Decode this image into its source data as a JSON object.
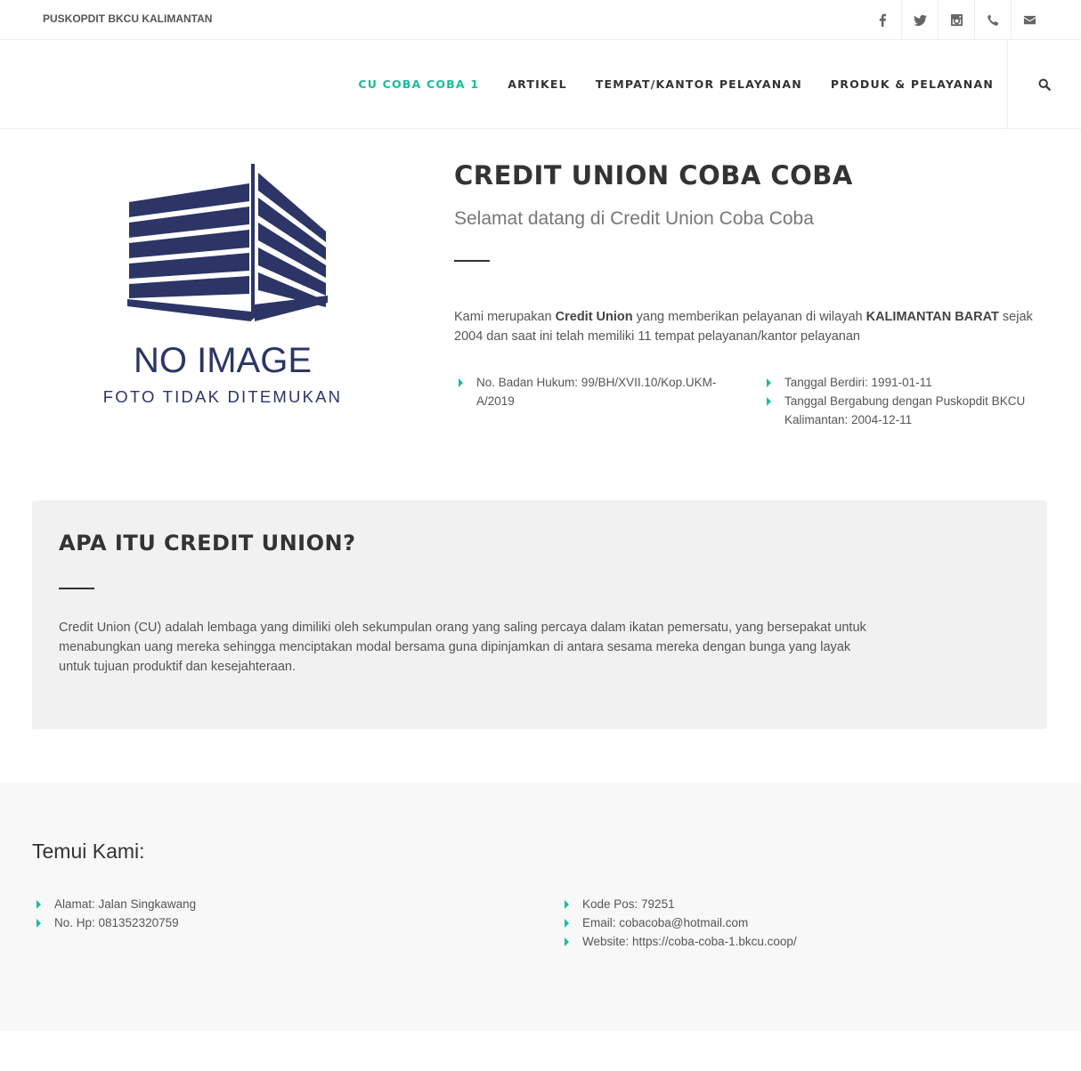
{
  "topbar": {
    "org_name": "PUSKOPDIT BKCU KALIMANTAN",
    "social_icons": [
      "facebook-icon",
      "twitter-icon",
      "instagram-icon",
      "phone-icon",
      "mail-icon"
    ]
  },
  "nav": {
    "items": [
      {
        "label": "CU COBA COBA 1",
        "active": true
      },
      {
        "label": "ARTIKEL",
        "active": false
      },
      {
        "label": "TEMPAT/KANTOR PELAYANAN",
        "active": false
      },
      {
        "label": "PRODUK & PELAYANAN",
        "active": false
      }
    ],
    "search_icon": "search-icon"
  },
  "hero": {
    "image_title": "NO IMAGE",
    "image_caption": "FOTO TIDAK DITEMUKAN",
    "title": "CREDIT UNION COBA COBA",
    "subtitle": "Selamat datang di Credit Union Coba Coba",
    "desc": {
      "p1": "Kami merupakan ",
      "b1": "Credit Union",
      "p2": " yang memberikan pelayanan di wilayah ",
      "b2": "KALIMANTAN BARAT",
      "p3": " sejak 2004 dan saat ini telah memiliki 11 tempat pelayanan/kantor pelayanan"
    },
    "facts_left": [
      "No. Badan Hukum: 99/BH/XVII.10/Kop.UKM-A/2019"
    ],
    "facts_right": [
      "Tanggal Berdiri: 1991-01-11",
      "Tanggal Bergabung dengan Puskopdit BKCU Kalimantan: 2004-12-11"
    ]
  },
  "about": {
    "title": "APA ITU CREDIT UNION?",
    "text": "Credit Union (CU) adalah lembaga yang dimiliki oleh sekumpulan orang yang saling percaya dalam ikatan pemersatu, yang bersepakat untuk menabungkan uang mereka sehingga menciptakan modal bersama guna dipinjamkan di antara sesama mereka dengan bunga yang layak untuk tujuan produktif dan kesejahteraan."
  },
  "footer": {
    "title": "Temui Kami:",
    "left": [
      "Alamat: Jalan Singkawang",
      "No. Hp: 081352320759"
    ],
    "right": [
      "Kode Pos: 79251",
      "Email: cobacoba@hotmail.com",
      "Website: https://coba-coba-1.bkcu.coop/"
    ]
  },
  "colors": {
    "accent": "#1abc9c",
    "logo_navy": "#2c3566",
    "box_bg": "#f1f1f1",
    "footer_bg": "#f8f8f8"
  }
}
